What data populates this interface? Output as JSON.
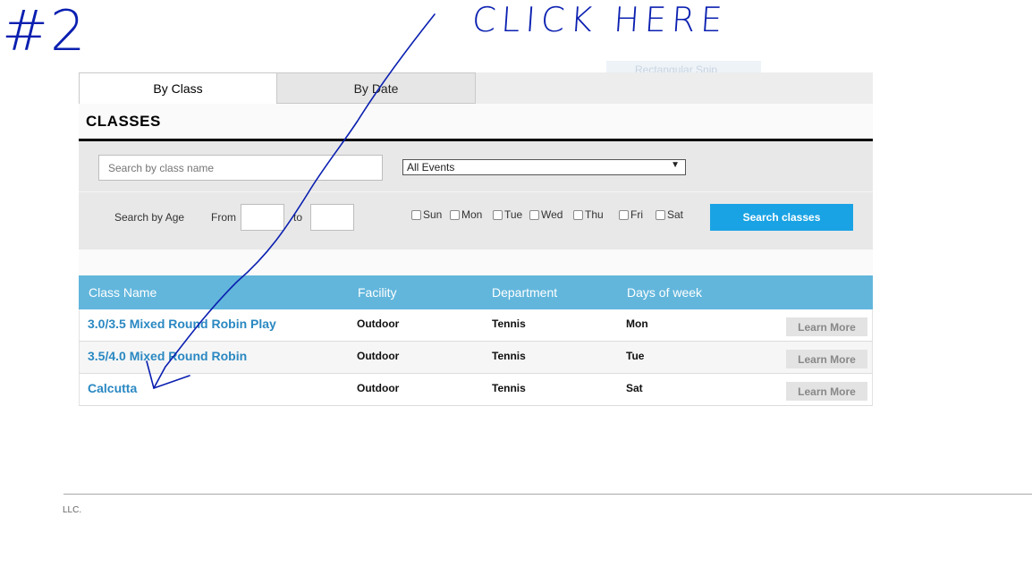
{
  "annotation": {
    "number": "#2",
    "instruction": "CLICK HERE",
    "color": "#0a1fb0"
  },
  "ghost_snip": {
    "label": "Rectangular Snip"
  },
  "tabs": [
    {
      "label": "By Class"
    },
    {
      "label": "By Date"
    }
  ],
  "section_title": "CLASSES",
  "filters": {
    "search_placeholder": "Search by class name",
    "event_select": "All Events",
    "age_label": "Search by Age",
    "from_label": "From",
    "to_label": "to",
    "days": [
      "Sun",
      "Mon",
      "Tue",
      "Wed",
      "Thu",
      "Fri",
      "Sat"
    ],
    "search_button": "Search classes"
  },
  "table": {
    "headers": [
      "Class Name",
      "Facility",
      "Department",
      "Days of week"
    ],
    "rows": [
      {
        "name": "3.0/3.5 Mixed Round Robin Play",
        "facility": "Outdoor",
        "department": "Tennis",
        "days": "Mon",
        "action": "Learn More"
      },
      {
        "name": "3.5/4.0 Mixed Round Robin",
        "facility": "Outdoor",
        "department": "Tennis",
        "days": "Tue",
        "action": "Learn More"
      },
      {
        "name": "Calcutta",
        "facility": "Outdoor",
        "department": "Tennis",
        "days": "Sat",
        "action": "Learn More"
      }
    ]
  },
  "footer": {
    "text": "LLC."
  },
  "colors": {
    "accent_button": "#1aa3e4",
    "table_header": "#62b6dc",
    "class_link": "#2a88c2"
  }
}
